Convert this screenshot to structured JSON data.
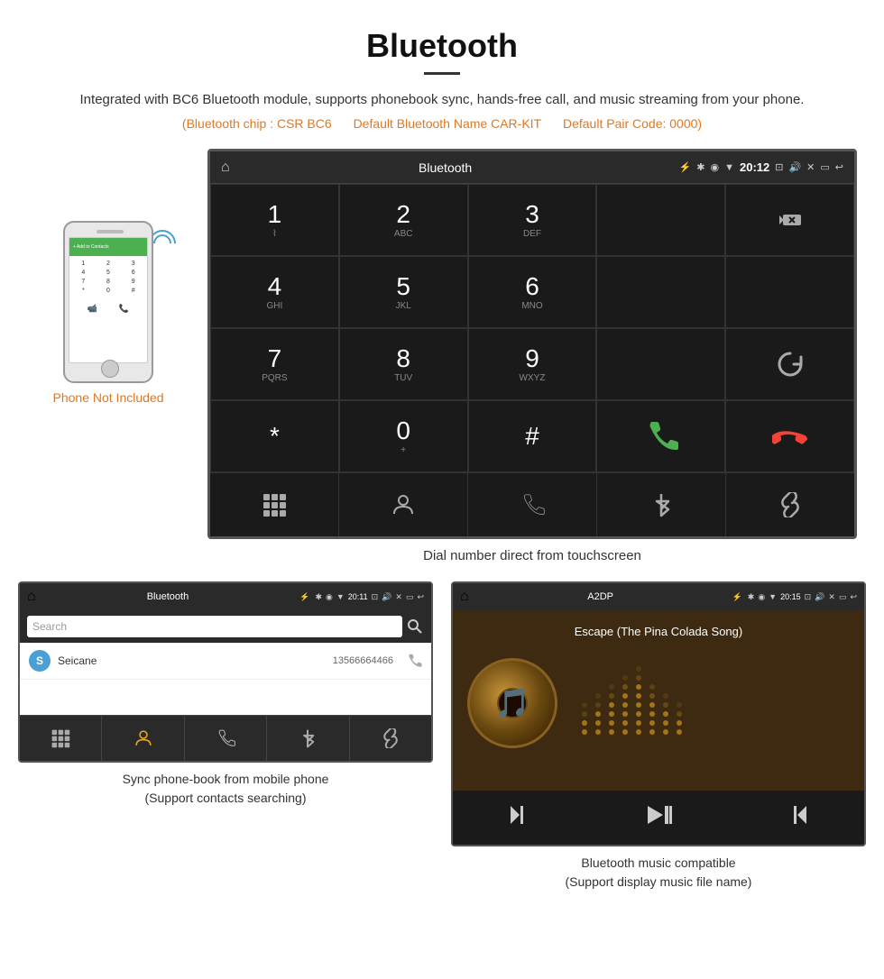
{
  "page": {
    "title": "Bluetooth",
    "divider": true,
    "description": "Integrated with BC6 Bluetooth module, supports phonebook sync, hands-free call, and music streaming from your phone.",
    "specs": {
      "chip": "(Bluetooth chip : CSR BC6",
      "name": "Default Bluetooth Name CAR-KIT",
      "code": "Default Pair Code: 0000)"
    },
    "main_screen": {
      "topbar": {
        "home_icon": "⌂",
        "title": "Bluetooth",
        "usb_icon": "⚡",
        "bt_icon": "✱",
        "location_icon": "◉",
        "wifi_icon": "▼",
        "time": "20:12",
        "camera_icon": "📷",
        "volume_icon": "🔊",
        "x_icon": "✕",
        "screen_icon": "▭",
        "back_icon": "↩"
      },
      "dialpad": [
        {
          "num": "1",
          "sub": ""
        },
        {
          "num": "2",
          "sub": "ABC"
        },
        {
          "num": "3",
          "sub": "DEF"
        },
        {
          "num": "",
          "sub": ""
        },
        {
          "num": "⌫",
          "sub": ""
        },
        {
          "num": "4",
          "sub": "GHI"
        },
        {
          "num": "5",
          "sub": "JKL"
        },
        {
          "num": "6",
          "sub": "MNO"
        },
        {
          "num": "",
          "sub": ""
        },
        {
          "num": "",
          "sub": ""
        },
        {
          "num": "7",
          "sub": "PQRS"
        },
        {
          "num": "8",
          "sub": "TUV"
        },
        {
          "num": "9",
          "sub": "WXYZ"
        },
        {
          "num": "",
          "sub": ""
        },
        {
          "num": "↻",
          "sub": ""
        },
        {
          "num": "*",
          "sub": ""
        },
        {
          "num": "0",
          "sub": "+"
        },
        {
          "num": "#",
          "sub": ""
        },
        {
          "num": "call_green",
          "sub": ""
        },
        {
          "num": "call_red",
          "sub": ""
        }
      ],
      "nav_items": [
        "⊞",
        "👤",
        "📞",
        "✱",
        "🔗"
      ]
    },
    "dial_caption": "Dial number direct from touchscreen",
    "phone_not_included": "Phone Not Included",
    "bottom_left": {
      "topbar": {
        "home": "⌂",
        "title": "Bluetooth",
        "usb": "⚡",
        "time": "20:11"
      },
      "search_placeholder": "Search",
      "contact": {
        "letter": "S",
        "name": "Seicane",
        "number": "13566664466"
      },
      "nav_items": [
        "⊞",
        "👤",
        "📞",
        "✱",
        "🔗"
      ],
      "caption_line1": "Sync phone-book from mobile phone",
      "caption_line2": "(Support contacts searching)"
    },
    "bottom_right": {
      "topbar": {
        "home": "⌂",
        "title": "A2DP",
        "usb": "⚡",
        "time": "20:15"
      },
      "song_title": "Escape (The Pina Colada Song)",
      "controls": [
        "⏮",
        "⏯",
        "⏭"
      ],
      "caption_line1": "Bluetooth music compatible",
      "caption_line2": "(Support display music file name)"
    }
  }
}
